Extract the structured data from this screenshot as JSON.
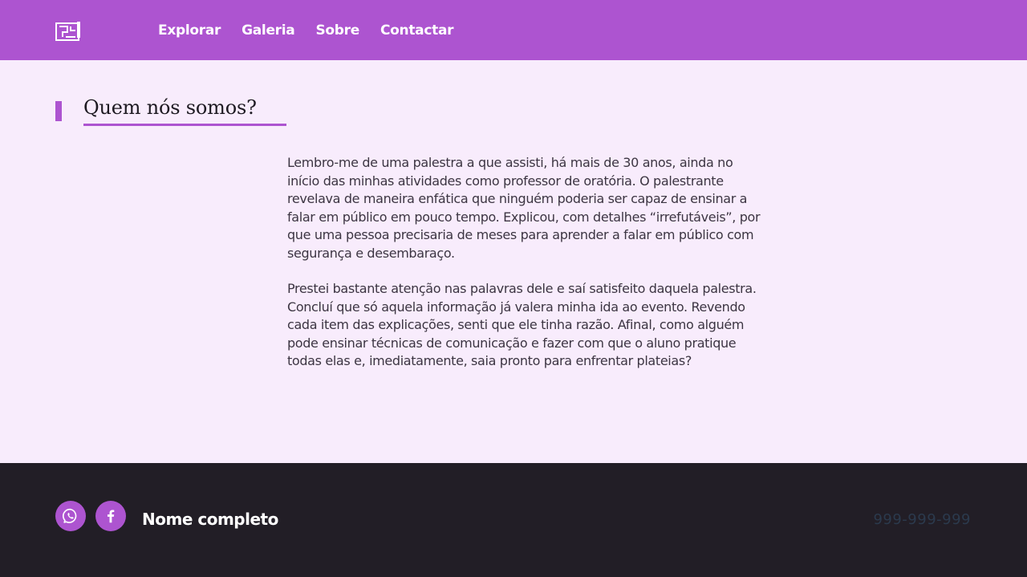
{
  "header": {
    "logo_icon": "blueprint-logo-icon",
    "nav": [
      {
        "label": "Explorar"
      },
      {
        "label": "Galeria"
      },
      {
        "label": "Sobre"
      },
      {
        "label": "Contactar"
      }
    ]
  },
  "main": {
    "title": "Quem nós somos?",
    "paragraphs": [
      "Lembro-me de uma palestra a que assisti, há mais de 30 anos, ainda no início das minhas atividades como professor de oratória. O palestrante revelava de maneira enfática que ninguém poderia ser capaz de ensinar a falar em público em pouco tempo. Explicou, com detalhes “irrefutáveis”, por que uma pessoa precisaria de meses para aprender a falar em público com segurança e desembaraço.",
      "Prestei bastante atenção nas palavras dele e saí satisfeito daquela palestra. Concluí que só aquela informação já valera minha ida ao evento. Revendo cada item das explicações, senti que ele tinha razão. Afinal, como alguém pode ensinar técnicas de comunicação e fazer com que o aluno pratique todas elas e, imediatamente, saia pronto para enfrentar plateias?"
    ]
  },
  "footer": {
    "social": [
      {
        "icon": "whatsapp-icon"
      },
      {
        "icon": "facebook-icon"
      }
    ],
    "name": "Nome completo",
    "phone": "999-999-999"
  },
  "colors": {
    "accent": "#ad54d0",
    "background": "#f8ecfc",
    "footer_bg": "#221e26",
    "phone_text": "#2b3a4d"
  }
}
